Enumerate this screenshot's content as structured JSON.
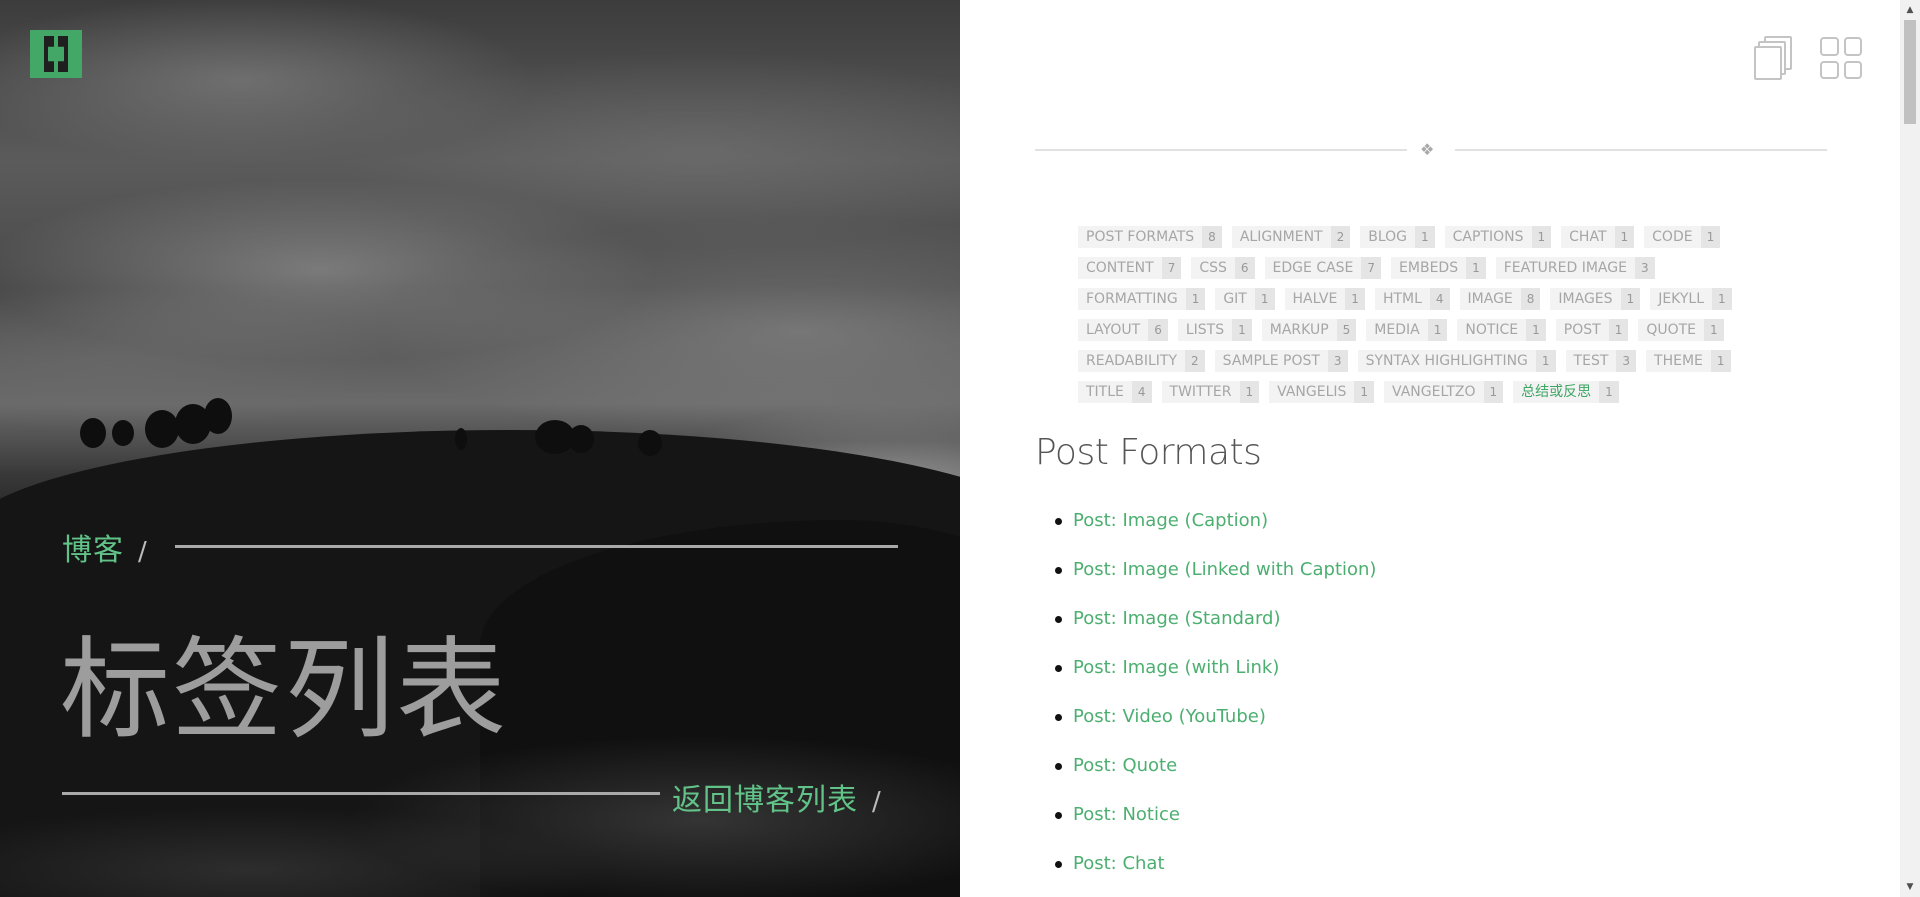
{
  "hero": {
    "breadcrumb": "博客",
    "breadcrumb_sep": "/",
    "title": "标签列表",
    "back_link": "返回博客列表",
    "back_sep": "/"
  },
  "colors": {
    "accent": "#43a867",
    "link": "#4caf70",
    "tag_text": "#a6a6a6"
  },
  "toolbar": {
    "icons": [
      "copy-icon",
      "grid-icon"
    ]
  },
  "divider_glyph": "❖",
  "tags": [
    {
      "name": "POST FORMATS",
      "count": "8"
    },
    {
      "name": "ALIGNMENT",
      "count": "2"
    },
    {
      "name": "BLOG",
      "count": "1"
    },
    {
      "name": "CAPTIONS",
      "count": "1"
    },
    {
      "name": "CHAT",
      "count": "1"
    },
    {
      "name": "CODE",
      "count": "1"
    },
    {
      "name": "CONTENT",
      "count": "7"
    },
    {
      "name": "CSS",
      "count": "6"
    },
    {
      "name": "EDGE CASE",
      "count": "7"
    },
    {
      "name": "EMBEDS",
      "count": "1"
    },
    {
      "name": "FEATURED IMAGE",
      "count": "3"
    },
    {
      "name": "FORMATTING",
      "count": "1"
    },
    {
      "name": "GIT",
      "count": "1"
    },
    {
      "name": "HALVE",
      "count": "1"
    },
    {
      "name": "HTML",
      "count": "4"
    },
    {
      "name": "IMAGE",
      "count": "8"
    },
    {
      "name": "IMAGES",
      "count": "1"
    },
    {
      "name": "JEKYLL",
      "count": "1"
    },
    {
      "name": "LAYOUT",
      "count": "6"
    },
    {
      "name": "LISTS",
      "count": "1"
    },
    {
      "name": "MARKUP",
      "count": "5"
    },
    {
      "name": "MEDIA",
      "count": "1"
    },
    {
      "name": "NOTICE",
      "count": "1"
    },
    {
      "name": "POST",
      "count": "1"
    },
    {
      "name": "QUOTE",
      "count": "1"
    },
    {
      "name": "READABILITY",
      "count": "2"
    },
    {
      "name": "SAMPLE POST",
      "count": "3"
    },
    {
      "name": "SYNTAX HIGHLIGHTING",
      "count": "1"
    },
    {
      "name": "TEST",
      "count": "3"
    },
    {
      "name": "THEME",
      "count": "1"
    },
    {
      "name": "TITLE",
      "count": "4"
    },
    {
      "name": "TWITTER",
      "count": "1"
    },
    {
      "name": "VANGELIS",
      "count": "1"
    },
    {
      "name": "VANGELTZO",
      "count": "1"
    },
    {
      "name": "总结或反思",
      "count": "1",
      "active": true
    }
  ],
  "section": {
    "title": "Post Formats",
    "posts": [
      "Post: Image (Caption)",
      "Post: Image (Linked with Caption)",
      "Post: Image (Standard)",
      "Post: Image (with Link)",
      "Post: Video (YouTube)",
      "Post: Quote",
      "Post: Notice",
      "Post: Chat"
    ]
  }
}
